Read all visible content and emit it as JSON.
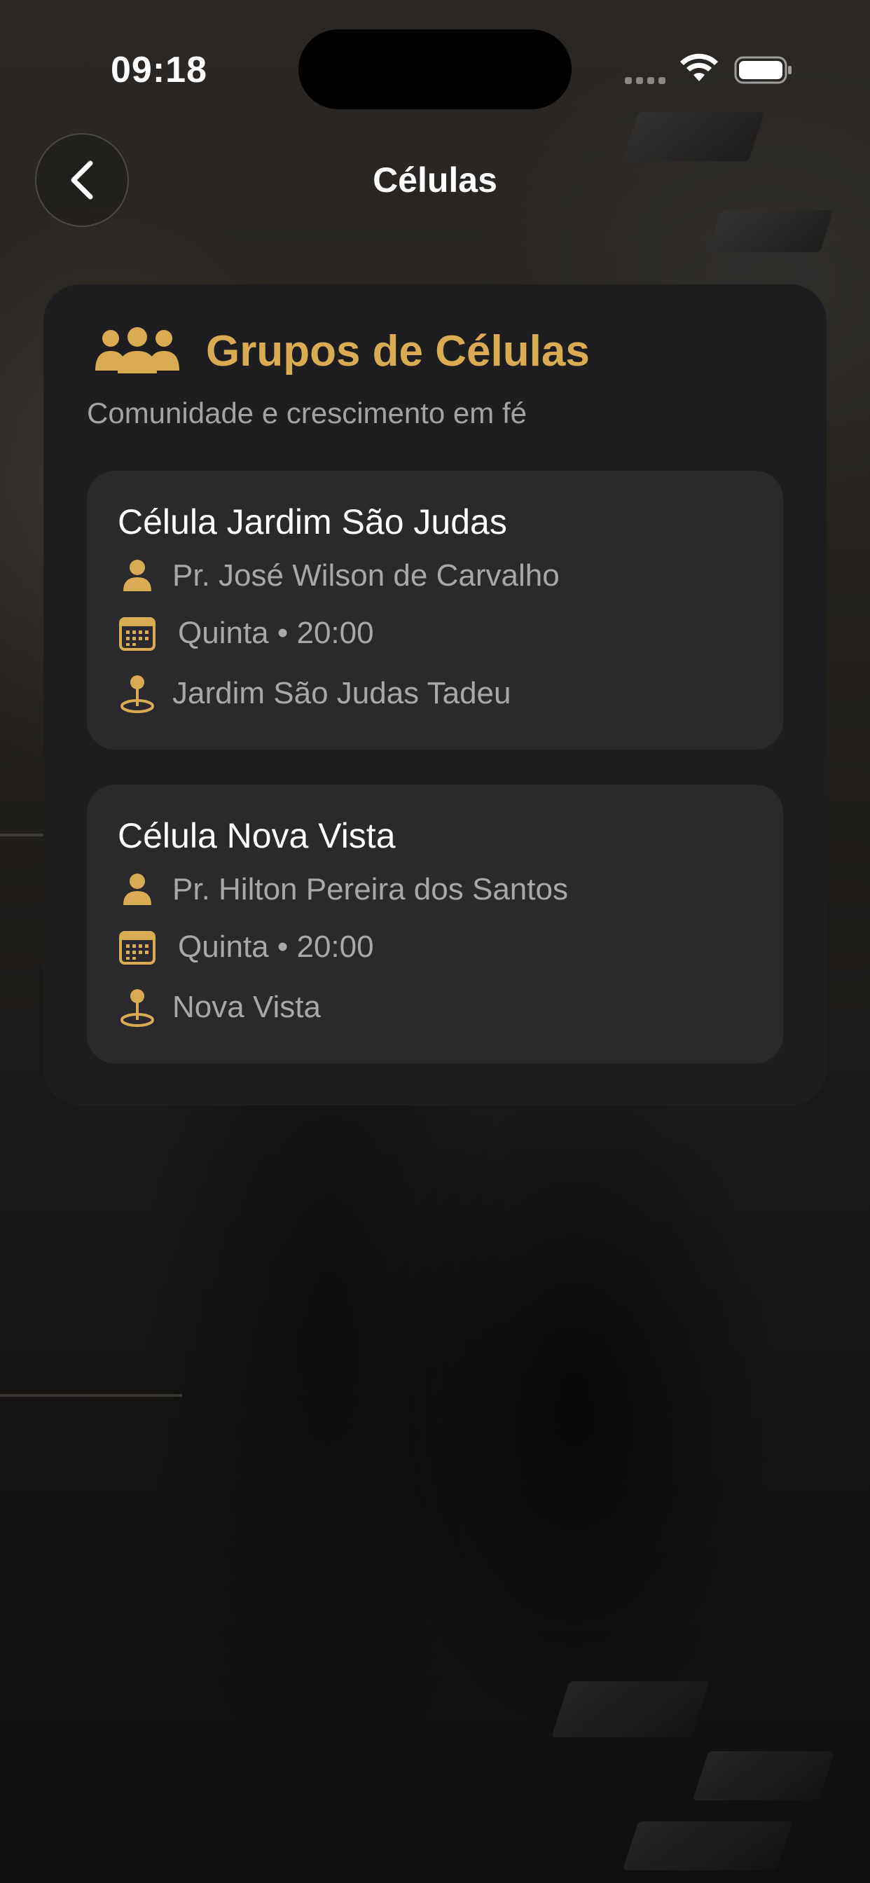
{
  "status_bar": {
    "time": "09:18"
  },
  "nav": {
    "title": "Células"
  },
  "card": {
    "title": "Grupos de Células",
    "subtitle": "Comunidade e crescimento em fé",
    "groups": [
      {
        "name": "Célula Jardim São Judas",
        "leader": "Pr. José Wilson de Carvalho",
        "schedule": "Quinta • 20:00",
        "location": "Jardim São Judas Tadeu"
      },
      {
        "name": "Célula Nova Vista",
        "leader": "Pr. Hilton Pereira dos Santos",
        "schedule": "Quinta • 20:00",
        "location": "Nova Vista"
      }
    ]
  },
  "icons": {
    "back": "chevron-left-icon",
    "group": "people-group-icon",
    "leader": "person-icon",
    "schedule": "calendar-icon",
    "location": "map-pin-icon"
  },
  "colors": {
    "accent": "#d9ab52",
    "card_bg": "#1e1e20",
    "item_bg": "#2a2a2c",
    "text_primary": "#ffffff",
    "text_secondary": "#a8a8ab"
  }
}
